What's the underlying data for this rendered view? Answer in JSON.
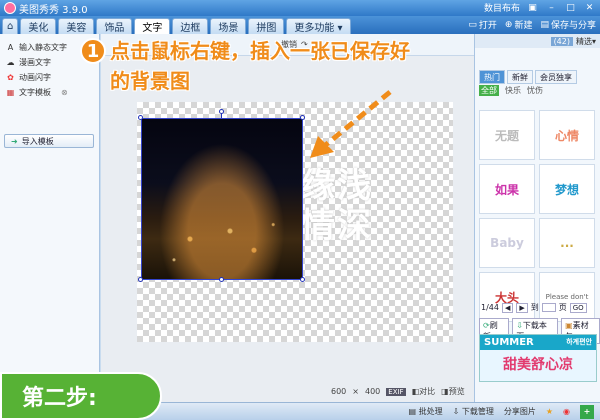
{
  "app": {
    "title": "美图秀秀 3.9.0",
    "account_text": "数目布布",
    "colors": {
      "accent": "#f08c1a",
      "title_bar": "#2f79c8",
      "step_badge": "#57b235"
    }
  },
  "tabs": {
    "home_icon": "home-icon",
    "items": [
      "美化",
      "美容",
      "饰品",
      "文字",
      "边框",
      "场景",
      "拼图",
      "更多功能 ▾"
    ],
    "active": "文字"
  },
  "tab_actions": {
    "open": "打开",
    "new": "新建",
    "save_share": "保存与分享"
  },
  "left_panel": {
    "items": [
      "输入静态文字",
      "漫画文字",
      "动画闪字",
      "文字模板"
    ],
    "import_button": "导入模板"
  },
  "canvas_toolbar": {
    "undo": "撤销"
  },
  "annotation": {
    "step_number": "1",
    "line1": "点击鼠标右键，插入一张已保存好",
    "line2": "的背景图"
  },
  "canvas": {
    "text_line1": "缘浅",
    "text_line2": "情深",
    "size_w": "600",
    "size_x": "×",
    "size_h": "400",
    "exif_badge": "EXIF",
    "compare": "对比",
    "preview": "预览"
  },
  "right_panel": {
    "dropdown": "精选",
    "count_badge": "(42)",
    "tabs": [
      "热门",
      "新鲜",
      "会员独享"
    ],
    "active_tab": "热门",
    "subtabs": [
      "全部",
      "快乐",
      "忧伤"
    ],
    "active_subtab": "全部",
    "thumbs": [
      "无题",
      "心情",
      "如果",
      "梦想",
      "Baby",
      "...",
      "大头",
      "Please don't"
    ],
    "pager": {
      "current": "1/44",
      "go_label": "到",
      "page_label": "页",
      "go_button": "GO"
    },
    "actions": {
      "refresh": "刷新",
      "download_page": "下载本页",
      "materials": "素材包"
    },
    "ad": {
      "top_left": "SUMMER",
      "top_right": "하계편안",
      "bottom": "甜美舒心凉"
    }
  },
  "statusbar": {
    "batch": "批处理",
    "download_mgr": "下载管理",
    "share": "分享图片"
  },
  "step_badge": "第二步:"
}
